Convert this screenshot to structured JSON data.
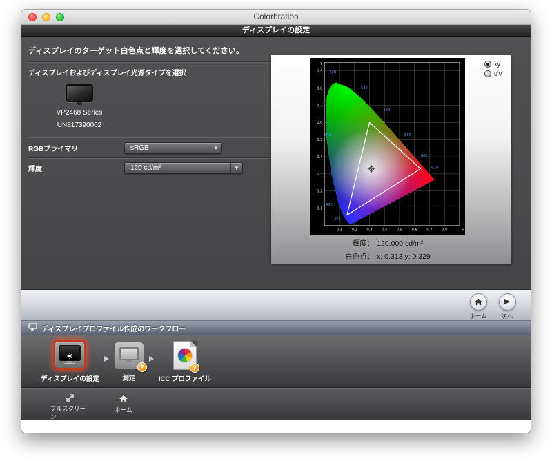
{
  "window": {
    "title": "Colorbration"
  },
  "header": {
    "title": "ディスプレイの設定"
  },
  "settings": {
    "instruction": "ディスプレイのターゲット白色点と輝度を選択してください。",
    "source_type_label": "ディスプレイおよびディスプレイ光源タイプを選択",
    "display_name": "VP2468 Series",
    "display_serial": "UN817390002",
    "rgb_primary_label": "RGBプライマリ",
    "rgb_primary_value": "sRGB",
    "luminance_label": "輝度",
    "luminance_value": "120 cd/m²"
  },
  "chart_panel": {
    "mode_options": {
      "xy": "xy",
      "uv": "u'v'"
    },
    "selected_mode": "xy",
    "luminance_label": "輝度：",
    "luminance_value": "120.000 cd/m²",
    "white_point_label": "白色点：",
    "white_point_value": "x: 0.313  y: 0.329"
  },
  "chart_data": {
    "type": "scatter",
    "note": "CIE 1931 xy chromaticity diagram with sRGB gamut triangle and target white point",
    "x_axis_label": "x",
    "y_axis_label": "y",
    "x_max": 0.9,
    "y_max": 0.95,
    "x_ticks": [
      "0.1",
      "0.2",
      "0.3",
      "0.4",
      "0.5",
      "0.6",
      "0.7",
      "0.8"
    ],
    "y_ticks": [
      "0.1",
      "0.2",
      "0.3",
      "0.4",
      "0.5",
      "0.6",
      "0.7",
      "0.8",
      "0.9"
    ],
    "white_point": {
      "x": 0.313,
      "y": 0.329
    },
    "srgb_gamut": {
      "red": [
        0.64,
        0.33
      ],
      "green": [
        0.3,
        0.6
      ],
      "blue": [
        0.15,
        0.06
      ]
    },
    "wavelength_labels": [
      {
        "label": "460",
        "x": 0.085,
        "y": 0.03
      },
      {
        "label": "480",
        "x": 0.03,
        "y": 0.115
      },
      {
        "label": "500",
        "x": 0.02,
        "y": 0.52
      },
      {
        "label": "520",
        "x": 0.055,
        "y": 0.885
      },
      {
        "label": "540",
        "x": 0.265,
        "y": 0.795
      },
      {
        "label": "560",
        "x": 0.415,
        "y": 0.665
      },
      {
        "label": "580",
        "x": 0.555,
        "y": 0.52
      },
      {
        "label": "600",
        "x": 0.665,
        "y": 0.4
      },
      {
        "label": "620",
        "x": 0.735,
        "y": 0.33
      }
    ]
  },
  "nav": {
    "home_label": "ホーム",
    "next_label": "次へ"
  },
  "workflow": {
    "title": "ディスプレイプロファイル作成のワークフロー",
    "steps": [
      {
        "label": "ディスプレイの設定",
        "state": "active",
        "badge": ""
      },
      {
        "label": "測定",
        "state": "pending",
        "badge": "?"
      },
      {
        "label": "ICC プロファイル",
        "state": "pending",
        "badge": "?"
      }
    ]
  },
  "toolbar": {
    "fullscreen_label": "フルスクリーン",
    "home_label": "ホーム"
  }
}
